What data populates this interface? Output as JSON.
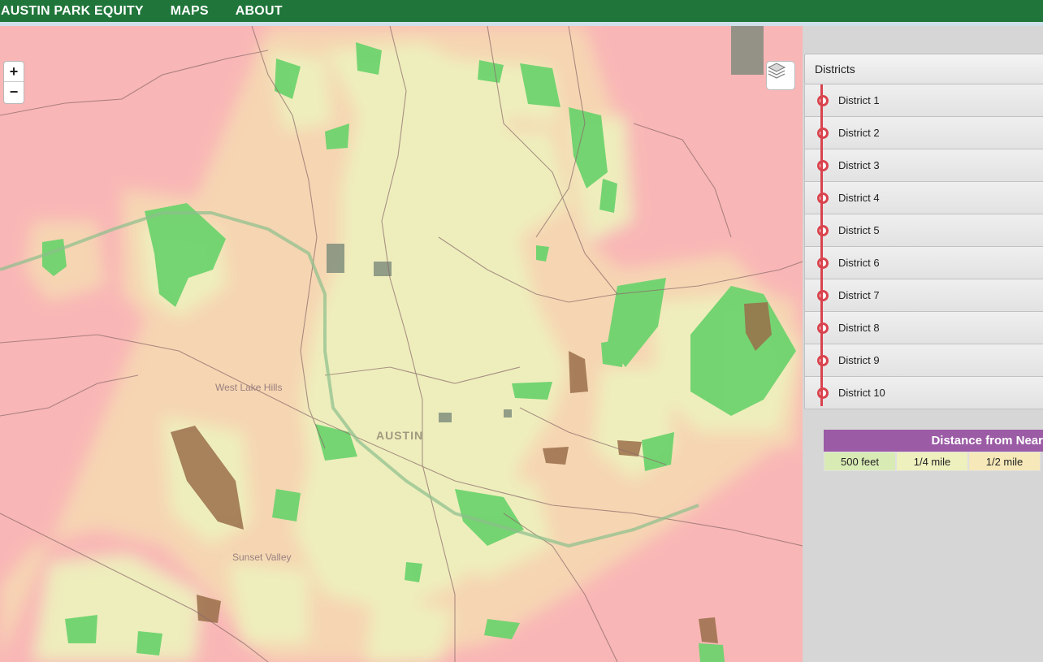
{
  "nav": {
    "items": [
      {
        "label": "AUSTIN PARK EQUITY"
      },
      {
        "label": "MAPS"
      },
      {
        "label": "ABOUT"
      }
    ]
  },
  "map": {
    "zoom_in": "+",
    "zoom_out": "−",
    "labels": {
      "west_lake_hills": "West Lake Hills",
      "austin": "AUSTIN",
      "sunset_valley": "Sunset Valley"
    },
    "layers_icon": "layers-icon"
  },
  "districts": {
    "header": "Districts",
    "items": [
      {
        "label": "District 1"
      },
      {
        "label": "District 2"
      },
      {
        "label": "District 3"
      },
      {
        "label": "District 4"
      },
      {
        "label": "District 5"
      },
      {
        "label": "District 6"
      },
      {
        "label": "District 7"
      },
      {
        "label": "District 8"
      },
      {
        "label": "District 9"
      },
      {
        "label": "District 10"
      }
    ]
  },
  "legend": {
    "title": "Distance from Near",
    "cells": [
      {
        "label": "500 feet",
        "color": "#d9ebb5"
      },
      {
        "label": "1/4 mile",
        "color": "#eef0bd"
      },
      {
        "label": "1/2 mile",
        "color": "#f6e8b8"
      }
    ]
  },
  "colors": {
    "nav": "#20763a",
    "far": "#f9b6b6",
    "half_mile": "#f6dcb0",
    "quarter_mile": "#eef0bd",
    "park": "#6ed36e",
    "accent_red": "#d9444e",
    "legend_header": "#9b5ba5"
  }
}
